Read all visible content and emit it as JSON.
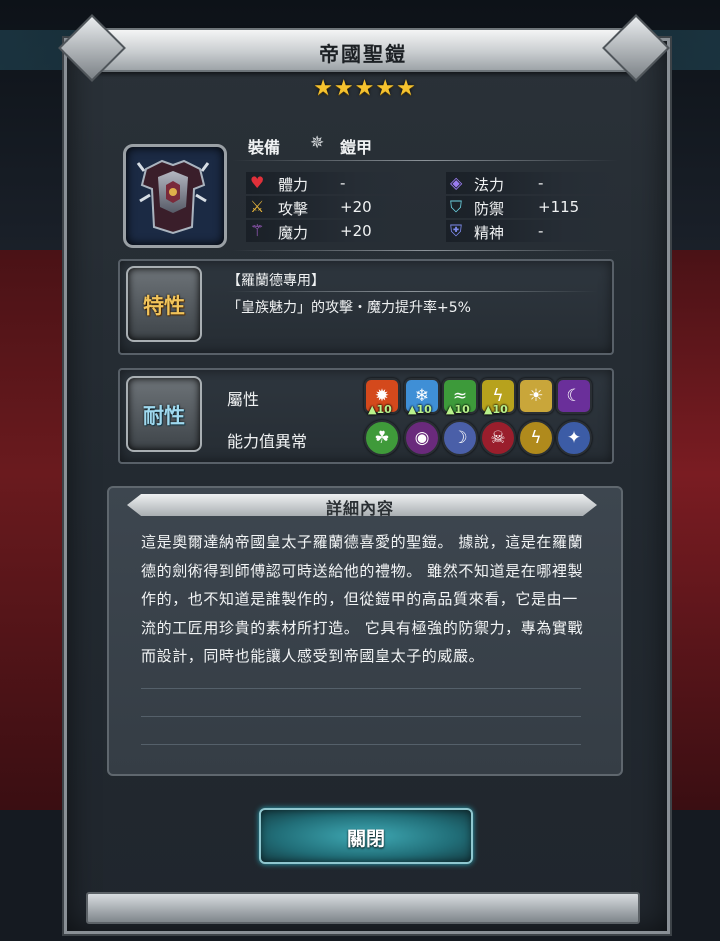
{
  "window": {
    "title": "帝國聖鎧"
  },
  "rarity": {
    "stars": "★★★★★",
    "count": 5,
    "color": "#f5c22e"
  },
  "equipment": {
    "icon": "armor-icon",
    "label": "裝備",
    "type_icon": "armor-type-icon",
    "type_label": "鎧甲"
  },
  "stats": [
    {
      "icon": "heart-icon",
      "name": "體力",
      "value": "-"
    },
    {
      "icon": "sword-icon",
      "name": "攻擊",
      "value": "+20"
    },
    {
      "icon": "staff-icon",
      "name": "魔力",
      "value": "+20"
    },
    {
      "icon": "magic-orb-icon",
      "name": "法力",
      "value": "-"
    },
    {
      "icon": "shield-icon",
      "name": "防禦",
      "value": "+115"
    },
    {
      "icon": "spirit-icon",
      "name": "精神",
      "value": "-"
    }
  ],
  "trait": {
    "badge": "特性",
    "title": "【羅蘭德專用】",
    "description": "「皇族魅力」的攻擊・魔力提升率+5%"
  },
  "resistance": {
    "badge": "耐性",
    "element_label": "屬性",
    "status_label": "能力值異常",
    "elements": [
      {
        "icon": "fire-icon",
        "level": "10",
        "color": "#d4491c"
      },
      {
        "icon": "ice-icon",
        "level": "10",
        "color": "#3f8fd6"
      },
      {
        "icon": "wind-icon",
        "level": "10",
        "color": "#3d9a3a"
      },
      {
        "icon": "thunder-icon",
        "level": "10",
        "color": "#b7a21d"
      },
      {
        "icon": "light-icon",
        "level": "",
        "color": "#c9a63a"
      },
      {
        "icon": "dark-icon",
        "level": "",
        "color": "#6a2f9a"
      }
    ],
    "status": [
      {
        "icon": "poison-icon",
        "color": "#3f9a3a"
      },
      {
        "icon": "blind-icon",
        "color": "#6a2a7c"
      },
      {
        "icon": "sleep-icon",
        "color": "#4a5fa8"
      },
      {
        "icon": "curse-icon",
        "color": "#9a1e2c"
      },
      {
        "icon": "paralyze-icon",
        "color": "#b08a1c"
      },
      {
        "icon": "confuse-icon",
        "color": "#3c5ca6"
      }
    ]
  },
  "detail": {
    "title": "詳細內容",
    "lines": [
      "這是奧爾達納帝國皇太子羅蘭德喜愛的聖鎧。 據說，這是在羅蘭",
      "德的劍術得到師傅認可時送給他的禮物。 雖然不知道是在哪裡製",
      "作的，也不知道是誰製作的，但從鎧甲的高品質來看，它是由一",
      "流的工匠用珍貴的素材所打造。 它具有極強的防禦力，專為實戰",
      "而設計，同時也能讓人感受到帝國皇太子的威嚴。"
    ]
  },
  "close_button": {
    "label": "關閉"
  }
}
